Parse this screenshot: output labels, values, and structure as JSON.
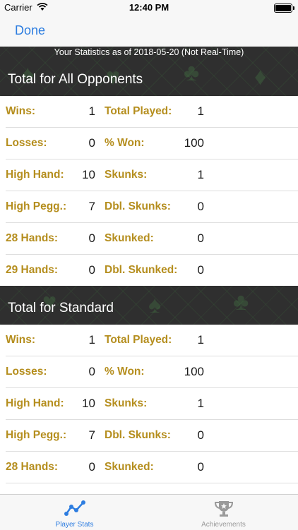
{
  "status_bar": {
    "carrier": "Carrier",
    "time": "12:40 PM"
  },
  "nav": {
    "done_label": "Done"
  },
  "stats_date": "Your Statistics as of 2018-05-20 (Not Real-Time)",
  "sections": [
    {
      "title": "Total for All Opponents",
      "rows": [
        {
          "l_label": "Wins:",
          "l_value": "1",
          "r_label": "Total Played:",
          "r_value": "1"
        },
        {
          "l_label": "Losses:",
          "l_value": "0",
          "r_label": "% Won:",
          "r_value": "100"
        },
        {
          "l_label": "High Hand:",
          "l_value": "10",
          "r_label": "Skunks:",
          "r_value": "1"
        },
        {
          "l_label": "High Pegg.:",
          "l_value": "7",
          "r_label": "Dbl. Skunks:",
          "r_value": "0"
        },
        {
          "l_label": "28 Hands:",
          "l_value": "0",
          "r_label": "Skunked:",
          "r_value": "0"
        },
        {
          "l_label": "29 Hands:",
          "l_value": "0",
          "r_label": "Dbl. Skunked:",
          "r_value": "0"
        }
      ]
    },
    {
      "title": "Total for Standard",
      "rows": [
        {
          "l_label": "Wins:",
          "l_value": "1",
          "r_label": "Total Played:",
          "r_value": "1"
        },
        {
          "l_label": "Losses:",
          "l_value": "0",
          "r_label": "% Won:",
          "r_value": "100"
        },
        {
          "l_label": "High Hand:",
          "l_value": "10",
          "r_label": "Skunks:",
          "r_value": "1"
        },
        {
          "l_label": "High Pegg.:",
          "l_value": "7",
          "r_label": "Dbl. Skunks:",
          "r_value": "0"
        },
        {
          "l_label": "28 Hands:",
          "l_value": "0",
          "r_label": "Skunked:",
          "r_value": "0"
        }
      ]
    }
  ],
  "tabs": [
    {
      "label": "Player Stats",
      "icon": "line-chart-icon",
      "active": true
    },
    {
      "label": "Achievements",
      "icon": "trophy-icon",
      "active": false
    }
  ],
  "colors": {
    "accent": "#2d7de0",
    "label_gold": "#b58e1e",
    "felt": "#2f2f2f"
  }
}
